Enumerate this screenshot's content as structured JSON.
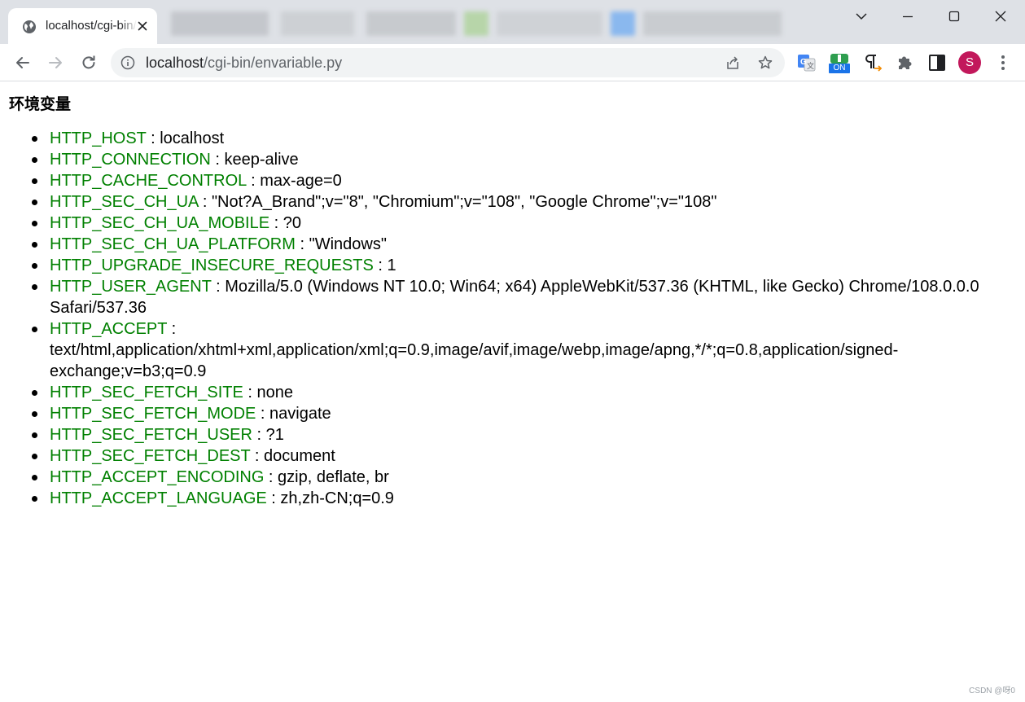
{
  "browser": {
    "tab": {
      "title": "localhost/cgi-bin/envariable.py"
    },
    "address_bar": {
      "url_host": "localhost",
      "url_path": "/cgi-bin/envariable.py"
    },
    "extensions": {
      "toggle_badge": "ON"
    },
    "profile_initial": "S"
  },
  "page": {
    "heading": "环境变量",
    "env_vars": [
      {
        "key": "HTTP_HOST",
        "value": "localhost"
      },
      {
        "key": "HTTP_CONNECTION",
        "value": "keep-alive"
      },
      {
        "key": "HTTP_CACHE_CONTROL",
        "value": "max-age=0"
      },
      {
        "key": "HTTP_SEC_CH_UA",
        "value": "\"Not?A_Brand\";v=\"8\", \"Chromium\";v=\"108\", \"Google Chrome\";v=\"108\""
      },
      {
        "key": "HTTP_SEC_CH_UA_MOBILE",
        "value": "?0"
      },
      {
        "key": "HTTP_SEC_CH_UA_PLATFORM",
        "value": "\"Windows\""
      },
      {
        "key": "HTTP_UPGRADE_INSECURE_REQUESTS",
        "value": "1"
      },
      {
        "key": "HTTP_USER_AGENT",
        "value": "Mozilla/5.0 (Windows NT 10.0; Win64; x64) AppleWebKit/537.36 (KHTML, like Gecko) Chrome/108.0.0.0 Safari/537.36"
      },
      {
        "key": "HTTP_ACCEPT",
        "value": "text/html,application/xhtml+xml,application/xml;q=0.9,image/avif,image/webp,image/apng,*/*;q=0.8,application/signed-exchange;v=b3;q=0.9"
      },
      {
        "key": "HTTP_SEC_FETCH_SITE",
        "value": "none"
      },
      {
        "key": "HTTP_SEC_FETCH_MODE",
        "value": "navigate"
      },
      {
        "key": "HTTP_SEC_FETCH_USER",
        "value": "?1"
      },
      {
        "key": "HTTP_SEC_FETCH_DEST",
        "value": "document"
      },
      {
        "key": "HTTP_ACCEPT_ENCODING",
        "value": "gzip, deflate, br"
      },
      {
        "key": "HTTP_ACCEPT_LANGUAGE",
        "value": "zh,zh-CN;q=0.9"
      }
    ],
    "watermark": "CSDN @呀0"
  },
  "colors": {
    "env_key": "#008000",
    "avatar": "#c2185b",
    "tabstrip": "#dee1e6",
    "omnibox": "#f1f3f4"
  },
  "icons": {
    "tab": [
      "globe-icon",
      "close-icon"
    ],
    "window": [
      "chevron-down-icon",
      "minimize-icon",
      "maximize-icon",
      "window-close-icon"
    ],
    "toolbar": [
      "back-arrow-icon",
      "forward-arrow-icon",
      "reload-icon",
      "info-icon",
      "share-icon",
      "star-icon",
      "translate-icon",
      "toggle-extension-icon",
      "pilcrow-icon",
      "puzzle-icon",
      "side-panel-icon",
      "kebab-menu-icon"
    ]
  }
}
